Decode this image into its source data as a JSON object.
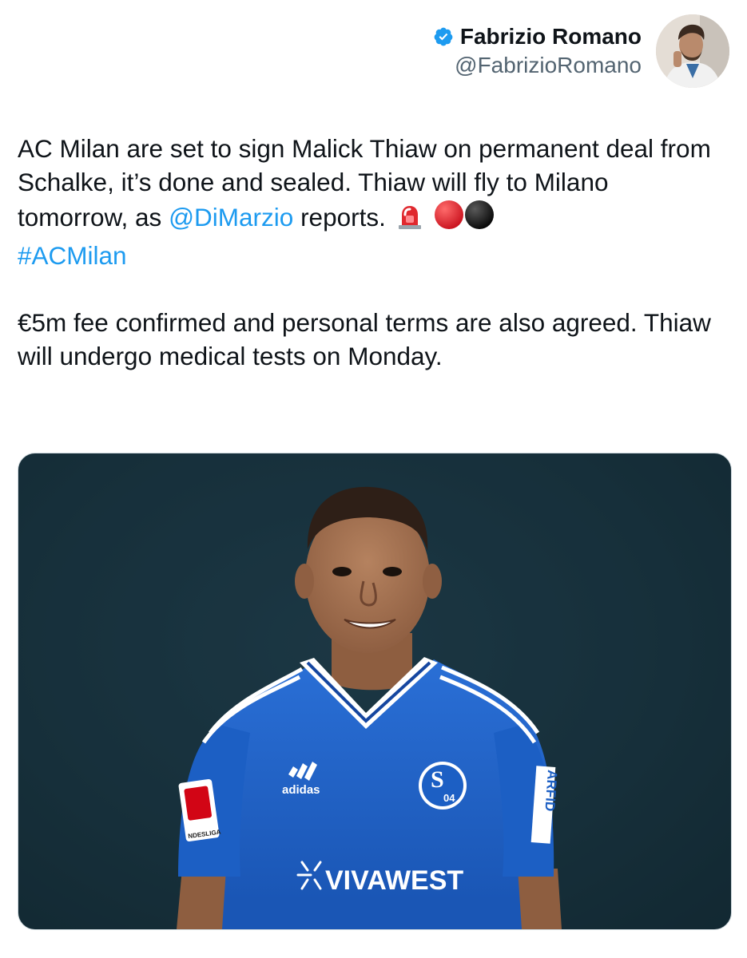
{
  "author": {
    "display_name": "Fabrizio Romano",
    "handle": "@FabrizioRomano",
    "verified_icon": "verified-badge-icon",
    "avatar_icon": "avatar-photo"
  },
  "tweet": {
    "line1_pre": "AC Milan are set to sign Malick Thiaw on permanent deal from Schalke, it’s done and sealed. Thiaw will fly to Milano tomorrow, as ",
    "mention": "@DiMarzio",
    "line1_post": " reports.",
    "emojis": [
      "police-light-emoji",
      "red-circle-emoji",
      "black-circle-emoji"
    ],
    "hashtag": "#ACMilan",
    "paragraph2": "€5m fee confirmed and personal terms are also agreed. Thiaw will undergo medical tests on Monday."
  },
  "media": {
    "description_icon": "player-photo",
    "kit_brand": "adidas",
    "sponsor": "VIVAWEST",
    "sleeve_text": "ARFID",
    "league_patch_text": "NDESLIGA",
    "crest_text": "04"
  },
  "colors": {
    "link": "#1d9bf0",
    "text": "#0f1419",
    "secondary": "#536471",
    "shirt": "#1c5fc4",
    "background": "#17303b"
  }
}
